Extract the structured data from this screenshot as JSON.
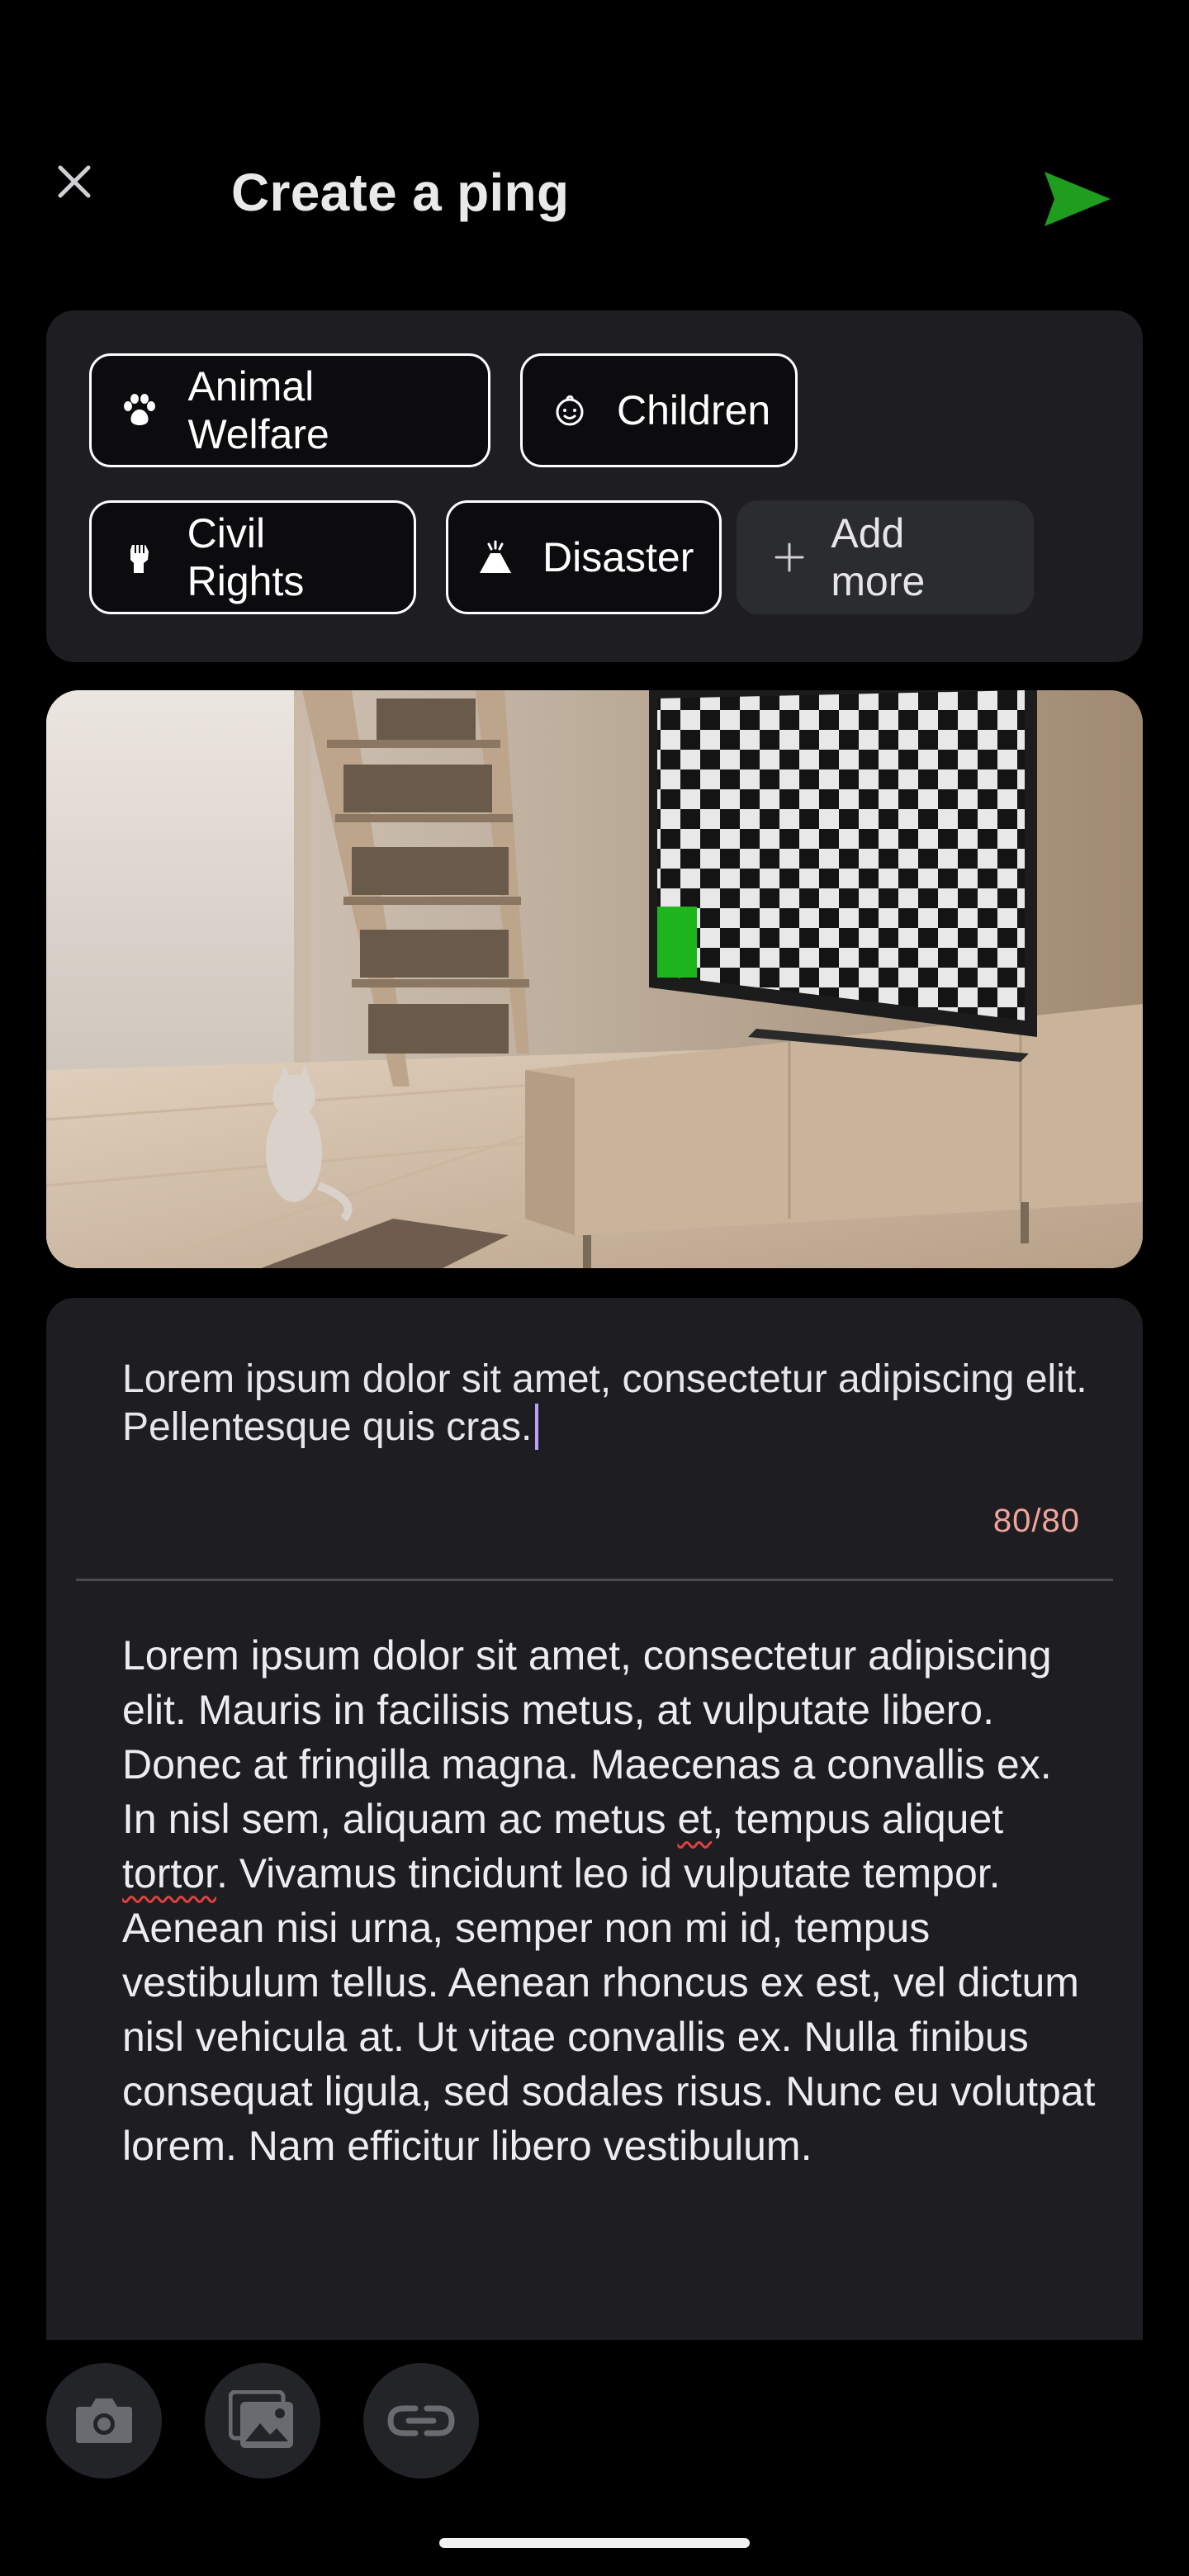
{
  "header": {
    "title": "Create a ping",
    "close_icon": "close-icon",
    "send_icon": "send-icon",
    "accent_color": "#1f9d1f"
  },
  "tags": {
    "items": [
      {
        "label": "Animal Welfare",
        "icon": "paw-icon"
      },
      {
        "label": "Children",
        "icon": "baby-face-icon"
      },
      {
        "label": "Civil Rights",
        "icon": "raised-fist-icon"
      },
      {
        "label": "Disaster",
        "icon": "volcano-icon"
      }
    ],
    "add_more_label": "Add more",
    "add_icon": "plus-icon"
  },
  "image": {
    "description": "living-room-scene",
    "icon": "photo"
  },
  "post": {
    "title_value": "Lorem ipsum dolor sit amet, consectetur adipiscing elit. Pellentesque quis cras.",
    "char_counter": "80/80",
    "body_parts": {
      "p1": "Lorem ipsum dolor sit amet, consectetur adipiscing elit. Mauris in facilisis metus, at vulputate libero. Donec at fringilla magna. Maecenas a convallis ex. In nisl sem, aliquam ac metus ",
      "w1": "et",
      "p2": ", tempus aliquet ",
      "w2": "tortor",
      "p3": ". Vivamus tincidunt leo id vulputate tempor. Aenean nisi urna, semper non mi id, tempus vestibulum tellus. Aenean rhoncus ex est, vel dictum nisl vehicula at. Ut vitae convallis ex. Nulla finibus consequat ligula, sed sodales risus. Nunc eu volutpat lorem. Nam efficitur libero vestibulum."
    }
  },
  "toolbar": {
    "items": [
      {
        "icon": "camera-icon"
      },
      {
        "icon": "gallery-icon"
      },
      {
        "icon": "link-icon"
      }
    ]
  }
}
